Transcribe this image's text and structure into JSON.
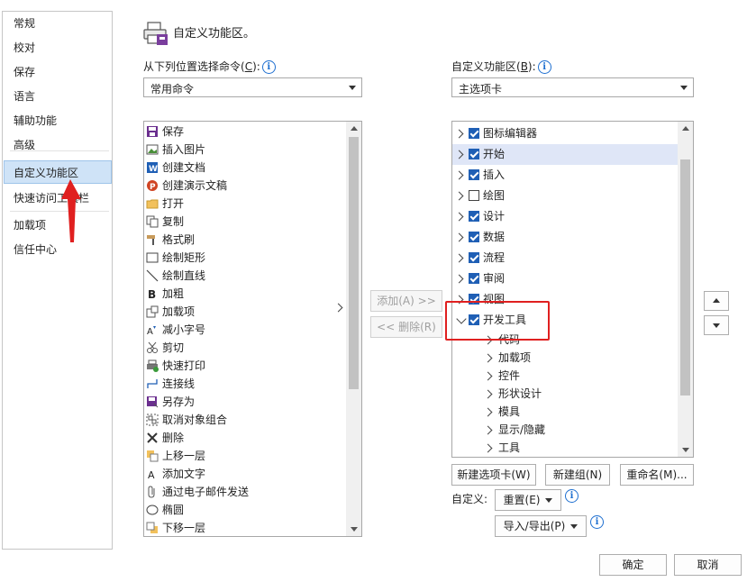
{
  "nav": {
    "items": [
      "常规",
      "校对",
      "保存",
      "语言",
      "辅助功能",
      "高级",
      "自定义功能区",
      "快速访问工具栏",
      "加载项",
      "信任中心"
    ],
    "selected": "自定义功能区"
  },
  "header": {
    "title": "自定义功能区。"
  },
  "left_panel": {
    "label": "从下列位置选择命令(",
    "label_key": "C",
    "label_end": "):",
    "dropdown_value": "常用命令",
    "commands": [
      {
        "label": "保存",
        "icon": "save-icon"
      },
      {
        "label": "插入图片",
        "icon": "picture-icon"
      },
      {
        "label": "创建文档",
        "icon": "word-icon"
      },
      {
        "label": "创建演示文稿",
        "icon": "powerpoint-icon"
      },
      {
        "label": "打开",
        "icon": "folder-icon"
      },
      {
        "label": "复制",
        "icon": "copy-icon"
      },
      {
        "label": "格式刷",
        "icon": "format-painter-icon"
      },
      {
        "label": "绘制矩形",
        "icon": "rectangle-icon"
      },
      {
        "label": "绘制直线",
        "icon": "line-icon"
      },
      {
        "label": "加粗",
        "icon": "bold-icon"
      },
      {
        "label": "加载项",
        "icon": "addin-icon"
      },
      {
        "label": "减小字号",
        "icon": "decrease-font-icon"
      },
      {
        "label": "剪切",
        "icon": "scissors-icon"
      },
      {
        "label": "快速打印",
        "icon": "quick-print-icon"
      },
      {
        "label": "连接线",
        "icon": "connector-icon"
      },
      {
        "label": "另存为",
        "icon": "save-as-icon"
      },
      {
        "label": "取消对象组合",
        "icon": "ungroup-icon"
      },
      {
        "label": "删除",
        "icon": "delete-icon"
      },
      {
        "label": "上移一层",
        "icon": "bring-forward-icon"
      },
      {
        "label": "添加文字",
        "icon": "text-icon"
      },
      {
        "label": "通过电子邮件发送",
        "icon": "attach-icon"
      },
      {
        "label": "椭圆",
        "icon": "ellipse-icon"
      },
      {
        "label": "下移一层",
        "icon": "send-backward-icon"
      }
    ]
  },
  "middle": {
    "add_label": "添加(A) >>",
    "remove_label": "<< 删除(R)"
  },
  "right_panel": {
    "label": "自定义功能区(",
    "label_key": "B",
    "label_end": "):",
    "dropdown_value": "主选项卡",
    "tabs": [
      {
        "label": "图标编辑器",
        "checked": true,
        "expanded": false
      },
      {
        "label": "开始",
        "checked": true,
        "expanded": false,
        "selected": true
      },
      {
        "label": "插入",
        "checked": true,
        "expanded": false
      },
      {
        "label": "绘图",
        "checked": false,
        "expanded": false
      },
      {
        "label": "设计",
        "checked": true,
        "expanded": false
      },
      {
        "label": "数据",
        "checked": true,
        "expanded": false
      },
      {
        "label": "流程",
        "checked": true,
        "expanded": false
      },
      {
        "label": "审阅",
        "checked": true,
        "expanded": false
      },
      {
        "label": "视图",
        "checked": true,
        "expanded": false
      },
      {
        "label": "开发工具",
        "checked": true,
        "expanded": true
      }
    ],
    "groups": [
      "代码",
      "加载项",
      "控件",
      "形状设计",
      "模具",
      "显示/隐藏",
      "工具"
    ],
    "new_tab": "新建选项卡(W)",
    "new_group": "新建组(N)",
    "rename": "重命名(M)...",
    "customize_label": "自定义:",
    "reset": "重置(E)",
    "import_export": "导入/导出(P)"
  },
  "footer": {
    "ok": "确定",
    "cancel": "取消"
  },
  "colors": {
    "accent": "#1f5fb5",
    "selection": "#cfe3f7",
    "annotation": "#e02020"
  }
}
